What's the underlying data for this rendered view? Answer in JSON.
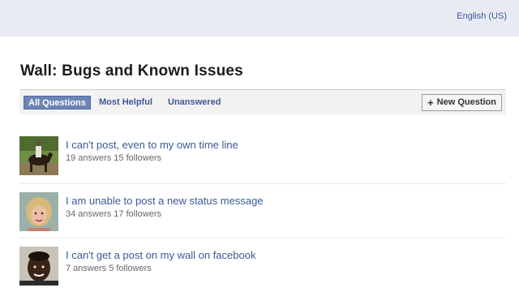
{
  "header": {
    "language": "English (US)"
  },
  "page": {
    "title": "Wall: Bugs and Known Issues"
  },
  "filters": {
    "tabs": [
      {
        "label": "All Questions",
        "active": true
      },
      {
        "label": "Most Helpful",
        "active": false
      },
      {
        "label": "Unanswered",
        "active": false
      }
    ],
    "new_question_icon": "+",
    "new_question_label": "New Question"
  },
  "questions": [
    {
      "title": "I can't post, even to my own time line",
      "meta": "19 answers 15 followers",
      "avatar": "photo-horse-rider"
    },
    {
      "title": "I am unable to post a new status message",
      "meta": "34 answers 17 followers",
      "avatar": "photo-woman-portrait"
    },
    {
      "title": "I can't get a post on my wall on facebook",
      "meta": "7 answers 5 followers",
      "avatar": "photo-man-portrait"
    }
  ],
  "colors": {
    "link": "#3b5998",
    "active_tab": "#6d84b4",
    "topbar": "#e9ebf3"
  }
}
